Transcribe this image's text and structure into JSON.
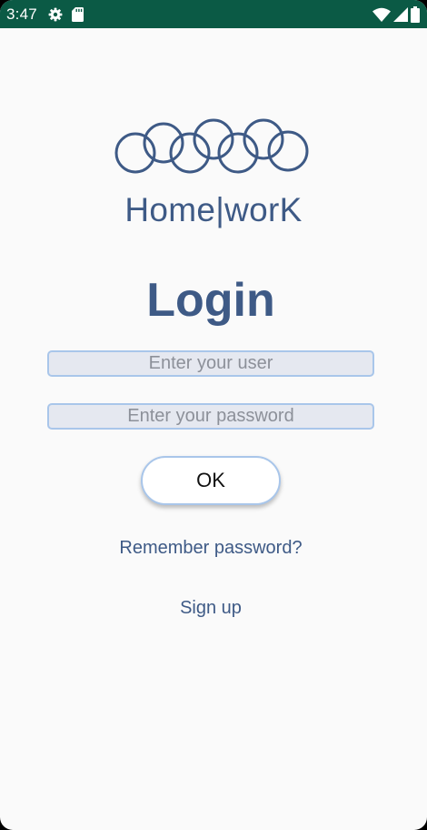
{
  "status_bar": {
    "time": "3:47",
    "left_icons": [
      "gear-icon",
      "sd-card-icon"
    ],
    "right_icons": [
      "wifi-icon",
      "signal-icon",
      "battery-icon"
    ],
    "background_color": "#0b5a45"
  },
  "brand": {
    "logo_icon": "interlocking-rings-logo",
    "app_name": "Home|worK",
    "color": "#3e5a86"
  },
  "login": {
    "title": "Login",
    "user_placeholder": "Enter your user",
    "user_value": "",
    "password_placeholder": "Enter your password",
    "password_value": "",
    "ok_label": "OK",
    "remember_label": "Remember password?",
    "signup_label": "Sign up"
  }
}
